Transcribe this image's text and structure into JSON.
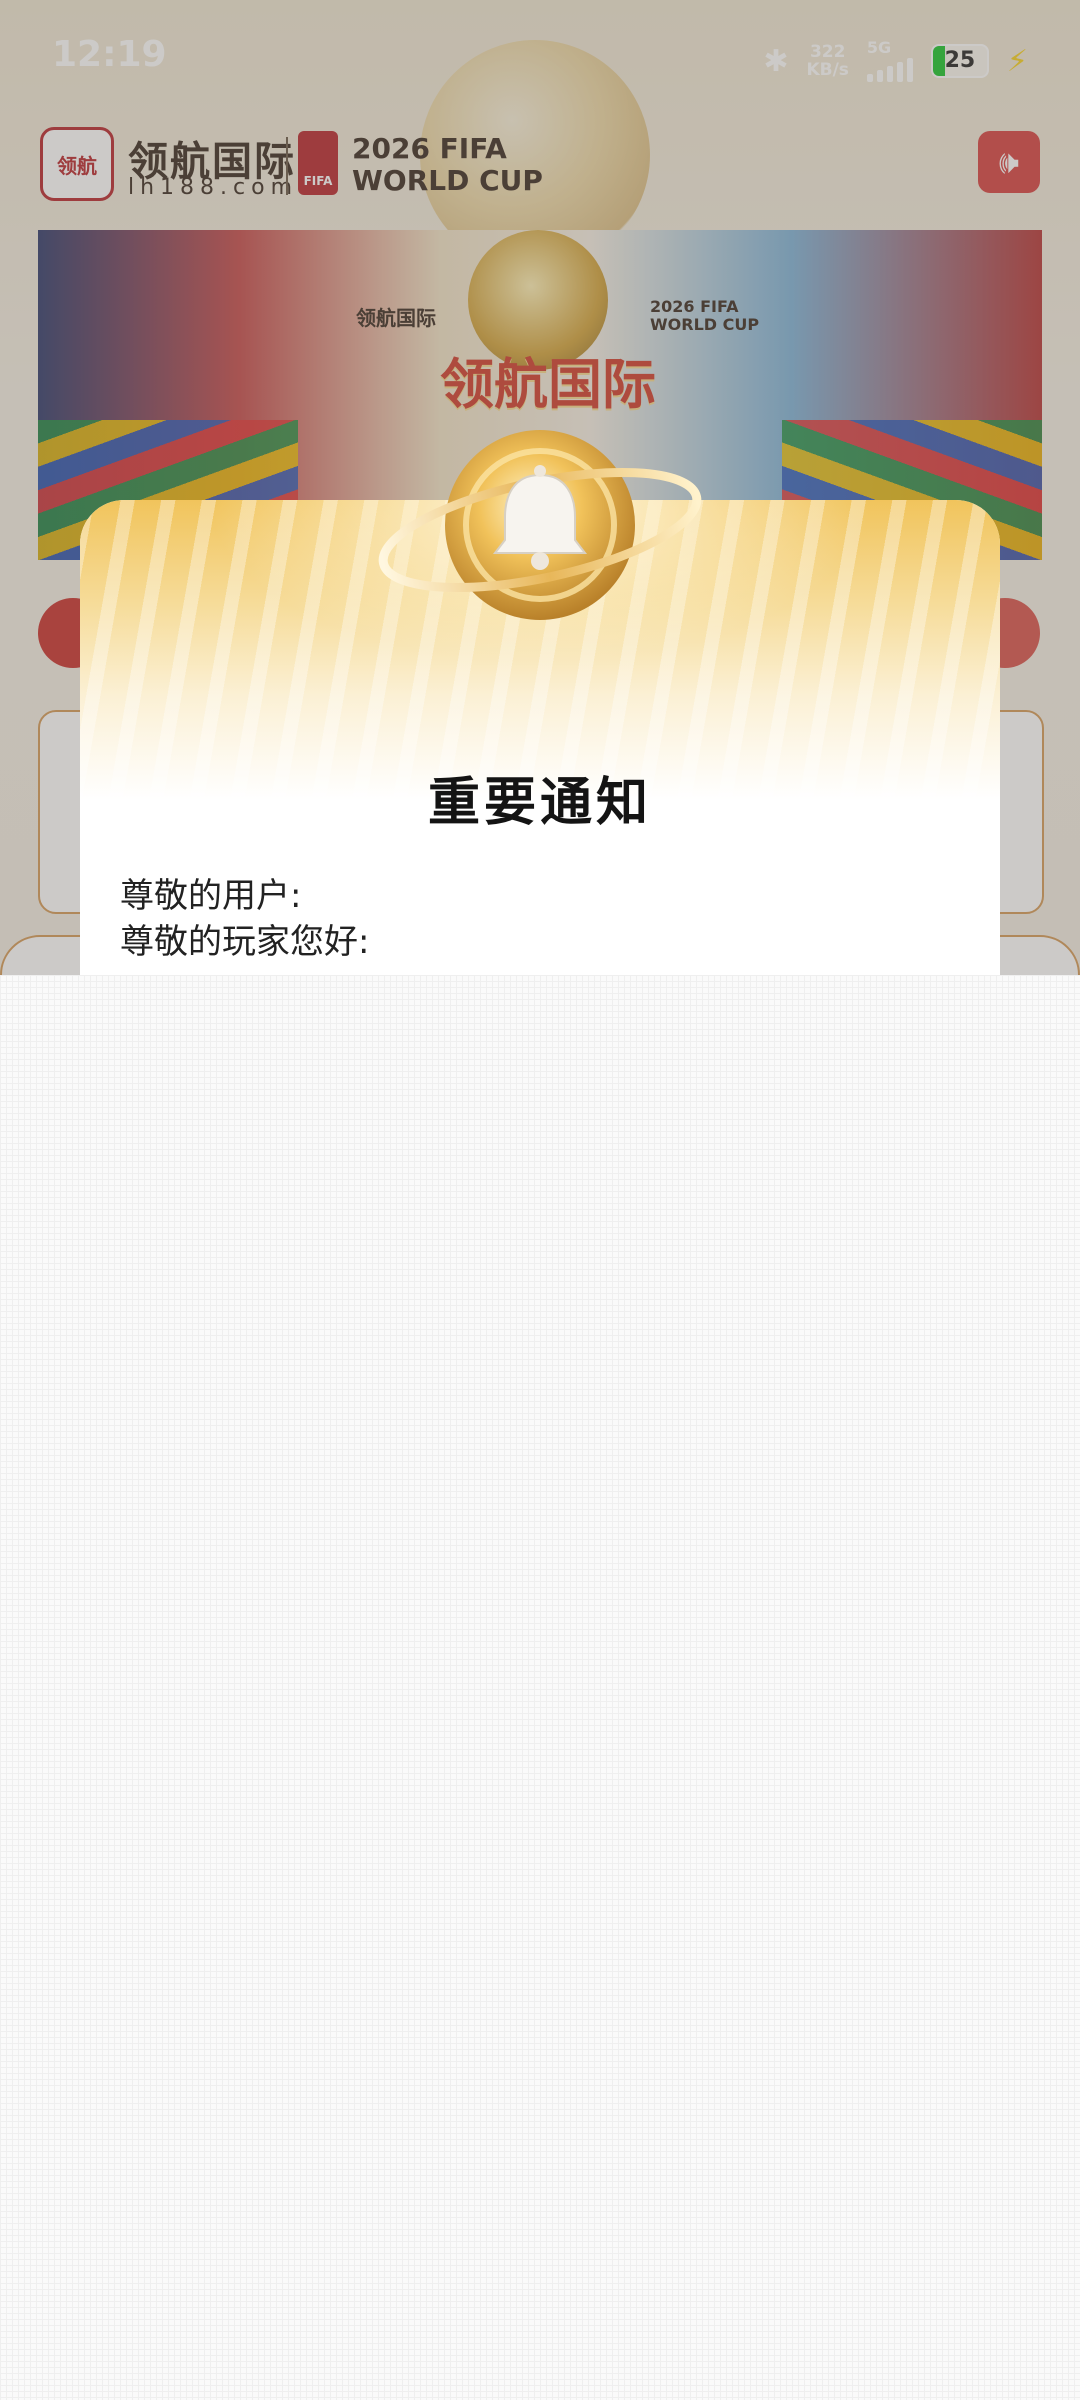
{
  "status_bar": {
    "time": "12:19",
    "net_speed_value": "322",
    "net_speed_unit": "KB/s",
    "network": "5G",
    "battery": "25"
  },
  "header": {
    "brand_name": "领航国际",
    "brand_url": "lh188.com",
    "badge_text": "领航",
    "world_cup_line1": "2026 FIFA",
    "world_cup_line2": "WORLD CUP",
    "fifa_text": "FIFA",
    "sound_icon": "speaker-icon"
  },
  "banner": {
    "slogan": "领航国际",
    "mini_brand": "领航国际",
    "mini_wc_line1": "2026 FIFA",
    "mini_wc_line2": "WORLD CUP"
  },
  "modal": {
    "title": "重要通知",
    "greeting_1": "尊敬的用户:",
    "greeting_2": "尊敬的玩家您好:",
    "icon": "bell-coin-icon"
  },
  "colors": {
    "brand_red": "#b9252b",
    "gold": "#d3a43b",
    "card_border": "#d59a57"
  }
}
